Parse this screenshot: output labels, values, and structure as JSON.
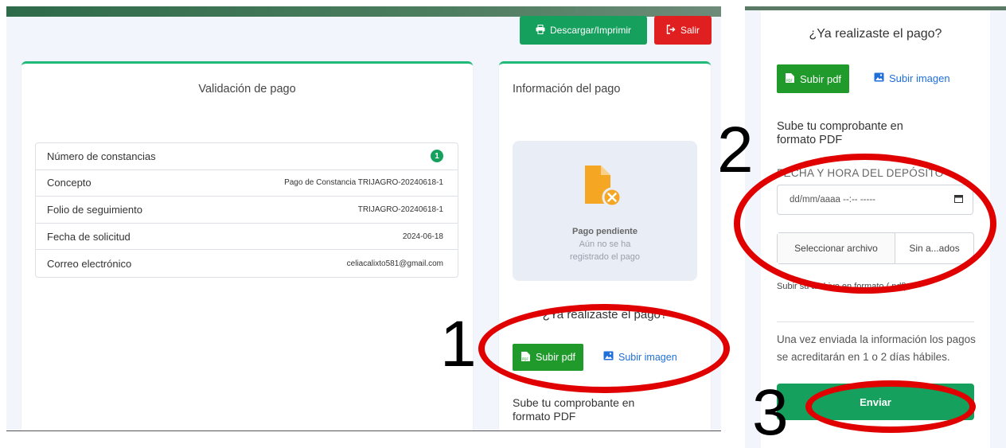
{
  "left_screen": {
    "header": {
      "download_label": "Descargar/Imprimir",
      "download_icon": "printer-icon",
      "exit_label": "Salir",
      "exit_icon": "sign-out-icon"
    },
    "validation": {
      "title": "Validación de pago",
      "rows": [
        {
          "label": "Número de constancias",
          "value": "1"
        },
        {
          "label": "Concepto",
          "value": "Pago de Constancia TRIJAGRO-20240618-1"
        },
        {
          "label": "Folio de seguimiento",
          "value": "TRIJAGRO-20240618-1"
        },
        {
          "label": "Fecha de solicitud",
          "value": "2024-06-18"
        },
        {
          "label": "Correo electrónico",
          "value": "celiacalixto581@gmail.com"
        }
      ]
    },
    "payment_info": {
      "title": "Información del pago",
      "status_title": "Pago pendiente",
      "status_line1": "Aún no se ha",
      "status_line2": "registrado el pago",
      "question": "¿Ya realizaste el pago?",
      "pdf_button": "Subir pdf",
      "image_link": "Subir imagen",
      "upload_title_line1": "Sube tu comprobante en",
      "upload_title_line2": "formato PDF"
    }
  },
  "right_screen": {
    "question": "¿Ya realizaste el pago?",
    "pdf_button": "Subir pdf",
    "image_link": "Subir imagen",
    "upload_title_line1": "Sube tu comprobante en",
    "upload_title_line2": "formato PDF",
    "date_label": "FECHA Y HORA DEL DEPÓSITO",
    "date_placeholder": "dd/mm/aaaa --:-- -----",
    "file_button": "Seleccionar archivo",
    "file_name": "Sin a...ados",
    "hint": "Subir su archivo en formato (.pdf).",
    "notice": "Una vez enviada la información los pagos se acreditarán en 1 o 2 días hábiles.",
    "send_button": "Enviar"
  },
  "annotations": {
    "step1": "1",
    "step2": "2",
    "step3": "3",
    "highlight_color": "#e00000"
  },
  "colors": {
    "primary_green": "#16a05d",
    "pdf_green": "#1f9a2b",
    "danger_red": "#e02020",
    "link_blue": "#1f6fd8",
    "file_icon_orange": "#f5a623"
  }
}
